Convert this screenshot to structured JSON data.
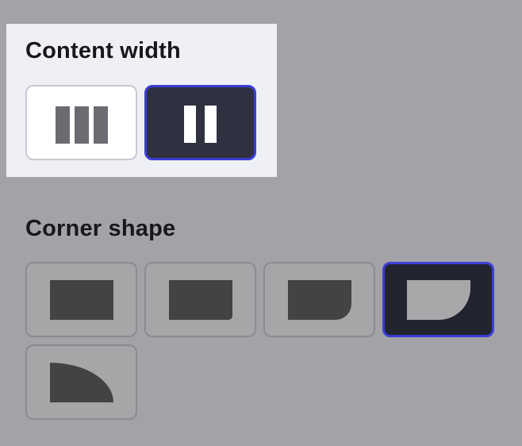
{
  "content_width": {
    "title": "Content width",
    "options": [
      {
        "id": "wide",
        "selected": false,
        "icon": "three-columns-icon"
      },
      {
        "id": "narrow",
        "selected": true,
        "icon": "two-columns-icon"
      }
    ]
  },
  "corner_shape": {
    "title": "Corner shape",
    "options": [
      {
        "id": "square",
        "selected": false,
        "icon": "square-corner-icon"
      },
      {
        "id": "slightly-rounded",
        "selected": false,
        "icon": "slightly-rounded-corner-icon"
      },
      {
        "id": "rounded",
        "selected": false,
        "icon": "rounded-corner-icon"
      },
      {
        "id": "extra-rounded",
        "selected": true,
        "icon": "extra-rounded-corner-icon"
      },
      {
        "id": "full-rounded",
        "selected": false,
        "icon": "full-rounded-corner-icon"
      }
    ]
  },
  "colors": {
    "background": "#a3a2a6",
    "panel": "#eff0f6",
    "selected_border": "#3c3ed8",
    "selected_fill": "#2f3140",
    "shape_fill": "#434346"
  }
}
